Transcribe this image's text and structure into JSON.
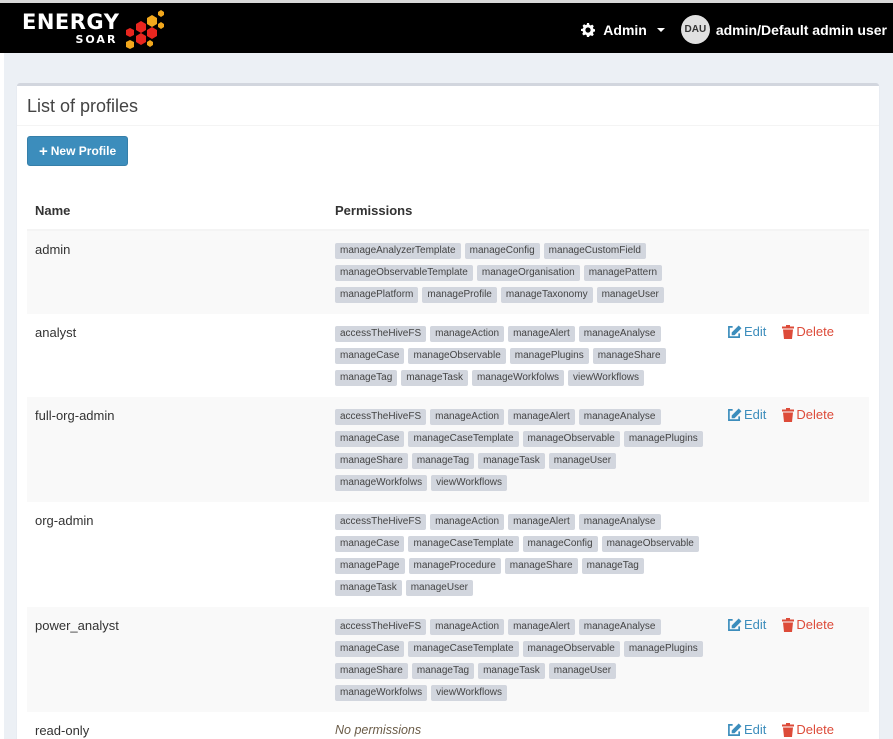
{
  "brand": {
    "name": "ENERGY",
    "sub": "SOAR"
  },
  "header": {
    "admin_label": "Admin",
    "avatar_initials": "DAU",
    "user_label": "admin/Default admin user"
  },
  "page": {
    "title": "List of profiles",
    "new_button": "New Profile"
  },
  "table": {
    "columns": [
      "Name",
      "Permissions"
    ],
    "rows": [
      {
        "name": "admin",
        "permissions": [
          "manageAnalyzerTemplate",
          "manageConfig",
          "manageCustomField",
          "manageObservableTemplate",
          "manageOrganisation",
          "managePattern",
          "managePlatform",
          "manageProfile",
          "manageTaxonomy",
          "manageUser"
        ],
        "actions": false
      },
      {
        "name": "analyst",
        "permissions": [
          "accessTheHiveFS",
          "manageAction",
          "manageAlert",
          "manageAnalyse",
          "manageCase",
          "manageObservable",
          "managePlugins",
          "manageShare",
          "manageTag",
          "manageTask",
          "manageWorkfolws",
          "viewWorkflows"
        ],
        "actions": true
      },
      {
        "name": "full-org-admin",
        "permissions": [
          "accessTheHiveFS",
          "manageAction",
          "manageAlert",
          "manageAnalyse",
          "manageCase",
          "manageCaseTemplate",
          "manageObservable",
          "managePlugins",
          "manageShare",
          "manageTag",
          "manageTask",
          "manageUser",
          "manageWorkfolws",
          "viewWorkflows"
        ],
        "actions": true
      },
      {
        "name": "org-admin",
        "permissions": [
          "accessTheHiveFS",
          "manageAction",
          "manageAlert",
          "manageAnalyse",
          "manageCase",
          "manageCaseTemplate",
          "manageConfig",
          "manageObservable",
          "managePage",
          "manageProcedure",
          "manageShare",
          "manageTag",
          "manageTask",
          "manageUser"
        ],
        "actions": false
      },
      {
        "name": "power_analyst",
        "permissions": [
          "accessTheHiveFS",
          "manageAction",
          "manageAlert",
          "manageAnalyse",
          "manageCase",
          "manageCaseTemplate",
          "manageObservable",
          "managePlugins",
          "manageShare",
          "manageTag",
          "manageTask",
          "manageUser",
          "manageWorkfolws",
          "viewWorkflows"
        ],
        "actions": true
      },
      {
        "name": "read-only",
        "permissions": [],
        "no_permissions_label": "No permissions",
        "actions": true
      }
    ],
    "edit_label": "Edit",
    "delete_label": "Delete"
  },
  "icons": {
    "settings": "gear-icon",
    "edit": "edit-icon",
    "delete": "trash-icon",
    "add": "plus-icon"
  },
  "colors": {
    "primary": "#3c8dbc",
    "danger": "#dd4b39",
    "topbar": "#000000",
    "tag": "#d2d6de"
  }
}
